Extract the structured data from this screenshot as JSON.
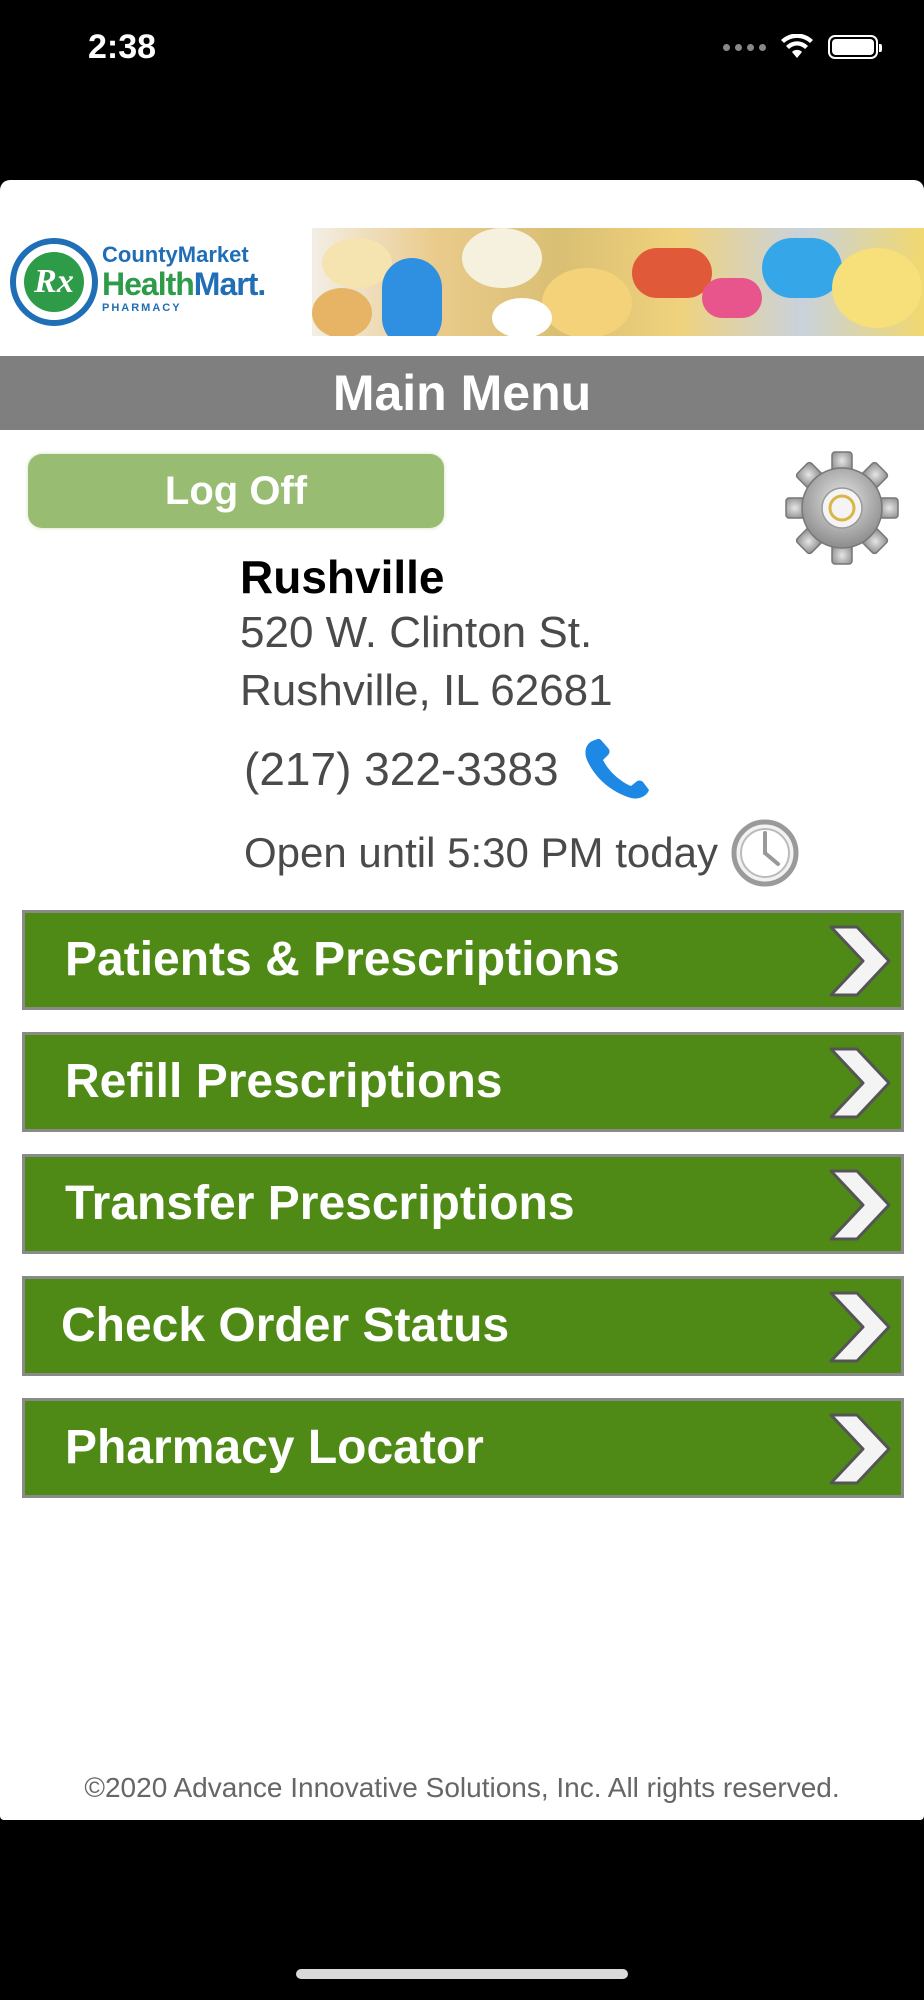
{
  "status_bar": {
    "time": "2:38"
  },
  "brand": {
    "county": "CountyMarket",
    "health": "Health",
    "mart": "Mart.",
    "pharmacy": "PHARMACY",
    "rx": "Rx"
  },
  "header": {
    "title": "Main Menu"
  },
  "actions": {
    "logoff_label": "Log Off"
  },
  "store": {
    "name": "Rushville",
    "address1": "520 W. Clinton St.",
    "address2": "Rushville, IL 62681",
    "phone": "(217) 322-3383",
    "hours": "Open until 5:30 PM today"
  },
  "menu": {
    "items": [
      {
        "label": "Patients & Prescriptions"
      },
      {
        "label": "Refill Prescriptions"
      },
      {
        "label": "Transfer Prescriptions"
      },
      {
        "label": "Check Order Status"
      },
      {
        "label": "Pharmacy Locator"
      }
    ]
  },
  "footer": {
    "copyright": "©2020 Advance Innovative Solutions, Inc. All rights reserved."
  },
  "icons": {
    "settings": "gear-icon",
    "phone": "phone-icon",
    "hours": "clock-icon",
    "menu_arrow": "chevron-right-icon"
  },
  "colors": {
    "menu_green": "#4f8a17",
    "logoff_green": "#98bd72",
    "title_gray": "#7f7f7f",
    "phone_blue": "#1e88e5"
  }
}
